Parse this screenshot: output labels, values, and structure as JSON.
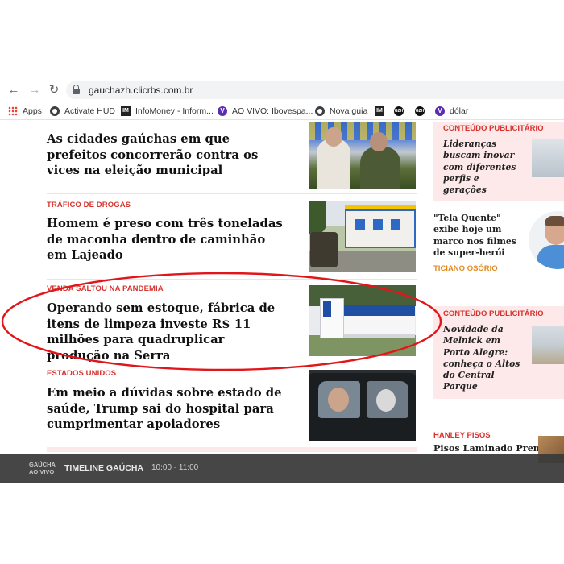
{
  "browser": {
    "url": "gauchazh.clicrbs.com.br",
    "bookmarks": [
      "Apps",
      "Activate HUD",
      "InfoMoney - Inform...",
      "AO VIVO: Ibovespa...",
      "Nova guia",
      "dólar"
    ],
    "bookmark_icons": {
      "im_1": "IM",
      "im_2": "IM",
      "gzh_1": "GZH",
      "gzh_2": "GZH",
      "v_1": "V",
      "v_2": "V"
    }
  },
  "feed": [
    {
      "kicker": "",
      "headline": "As cidades gaúchas em que prefeitos concorrerão contra os vices na eleição municipal"
    },
    {
      "kicker": "TRÁFICO DE DROGAS",
      "headline": "Homem é preso com três toneladas de maconha dentro de caminhão em Lajeado"
    },
    {
      "kicker": "VENDA SALTOU NA PANDEMIA",
      "headline": "Operando sem estoque, fábrica de itens de limpeza investe R$ 11 milhões para quadruplicar produção na Serra"
    },
    {
      "kicker": "ESTADOS UNIDOS",
      "headline": "Em meio a dúvidas sobre estado de saúde, Trump sai do hospital para cumprimentar apoiadores"
    }
  ],
  "sidebar": {
    "pub1_label": "CONTEÚDO PUBLICITÁRIO",
    "pub1_text": "Lideranças buscam inovar com diferentes perfis e gerações",
    "column_text": "\"Tela Quente\" exibe hoje um marco nos filmes de super-herói",
    "column_author": "TICIANO OSÓRIO",
    "pub2_label": "CONTEÚDO PUBLICITÁRIO",
    "pub2_text": "Novidade da Melnick em Porto Alegre: conheça o Altos do Central Parque",
    "ad_label": "HANLEY PISOS",
    "ad_text": "Pisos Laminado Premium"
  },
  "live_bar": {
    "tag_line1": "GAÚCHA",
    "tag_line2": "AO VIVO",
    "program": "TIMELINE GAÚCHA",
    "time": "10:00 - 11:00"
  },
  "colors": {
    "kicker": "#d6332e",
    "author": "#e08a1e",
    "pub_bg": "#fde9e9",
    "annotation": "#e0161b"
  }
}
